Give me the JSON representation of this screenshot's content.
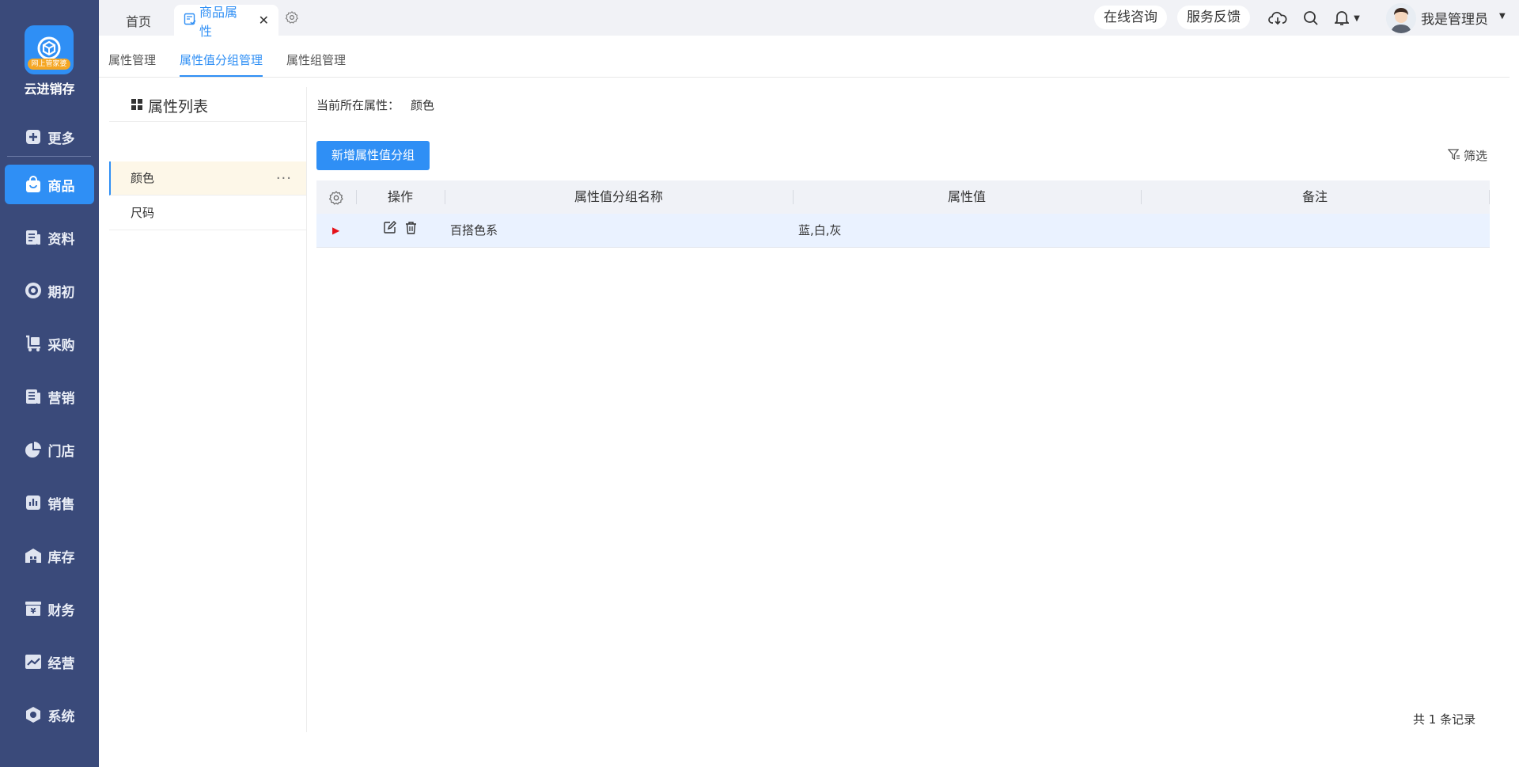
{
  "sidebar": {
    "logo_badge": "网上管家婆",
    "brand": "云进销存",
    "items": [
      {
        "label": "更多",
        "icon": "plus-icon"
      },
      {
        "label": "商品",
        "icon": "bag-icon"
      },
      {
        "label": "资料",
        "icon": "document-icon"
      },
      {
        "label": "期初",
        "icon": "target-icon"
      },
      {
        "label": "采购",
        "icon": "cart-icon"
      },
      {
        "label": "营销",
        "icon": "newspaper-icon"
      },
      {
        "label": "门店",
        "icon": "pie-icon"
      },
      {
        "label": "销售",
        "icon": "chart-icon"
      },
      {
        "label": "库存",
        "icon": "warehouse-icon"
      },
      {
        "label": "财务",
        "icon": "yen-icon"
      },
      {
        "label": "经营",
        "icon": "trend-icon"
      },
      {
        "label": "系统",
        "icon": "hexagon-icon"
      }
    ],
    "active_index": 1
  },
  "topbar": {
    "tabs": [
      {
        "label": "首页"
      },
      {
        "label": "商品属性",
        "icon": "attribute-icon"
      }
    ],
    "consult": "在线咨询",
    "feedback": "服务反馈",
    "user_name": "我是管理员"
  },
  "subtabs": [
    "属性管理",
    "属性值分组管理",
    "属性组管理"
  ],
  "active_subtab": 1,
  "attribute_panel": {
    "title": "属性列表",
    "items": [
      "颜色",
      "尺码"
    ],
    "more": "···"
  },
  "main": {
    "current_label": "当前所在属性：",
    "current_value": "颜色",
    "add_button": "新增属性值分组",
    "filter_label": "筛选",
    "table": {
      "headers": [
        "操作",
        "属性值分组名称",
        "属性值",
        "备注"
      ],
      "rows": [
        {
          "arrow": "▶",
          "name": "百搭色系",
          "values": "蓝,白,灰",
          "note": ""
        }
      ]
    },
    "total": "共 1 条记录"
  },
  "colors": {
    "sidebar_bg": "#3a4a7a",
    "accent": "#2f8ff5",
    "selected_row": "#eaf2ff",
    "selected_item": "#fdf7e8",
    "expand_arrow": "#e5121a"
  }
}
